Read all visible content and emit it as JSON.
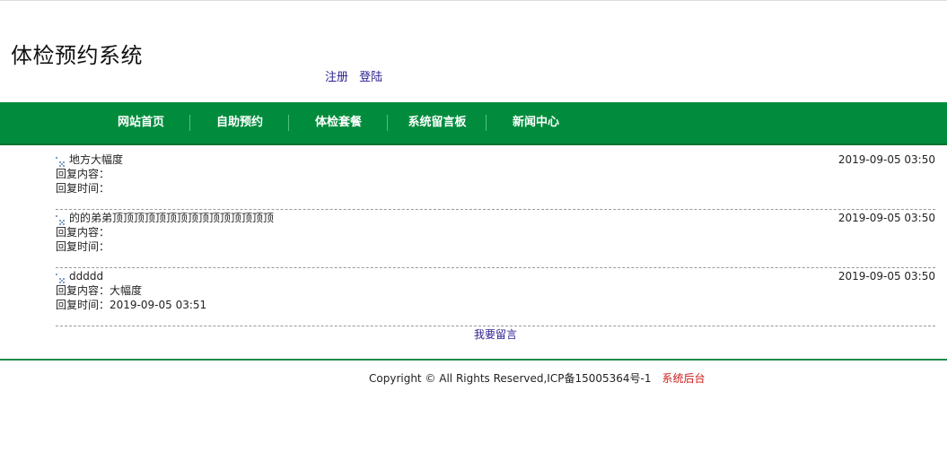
{
  "header": {
    "site_title": "体检预约系统",
    "register_label": "注册",
    "login_label": "登陆"
  },
  "nav": {
    "items": [
      "网站首页",
      "自助预约",
      "体检套餐",
      "系统留言板",
      "新闻中心"
    ]
  },
  "messages": [
    {
      "title": "地方大幅度",
      "date": "2019-09-05 03:50",
      "reply_content_label": "回复内容：",
      "reply_content": "",
      "reply_time_label": "回复时间：",
      "reply_time": ""
    },
    {
      "title": "的的弟弟顶顶顶顶顶顶顶顶顶顶顶顶顶顶顶",
      "date": "2019-09-05 03:50",
      "reply_content_label": "回复内容：",
      "reply_content": "",
      "reply_time_label": "回复时间：",
      "reply_time": ""
    },
    {
      "title": "ddddd",
      "date": "2019-09-05 03:50",
      "reply_content_label": "回复内容：",
      "reply_content": "大幅度",
      "reply_time_label": "回复时间：",
      "reply_time": "2019-09-05 03:51"
    }
  ],
  "post_message_label": "我要留言",
  "footer": {
    "copyright": "Copyright © All Rights Reserved,ICP备15005364号-1",
    "admin_link": "系统后台"
  },
  "colors": {
    "nav_bg": "#008c3c",
    "link": "#2a1f8f",
    "admin_link": "#d01a1a"
  }
}
